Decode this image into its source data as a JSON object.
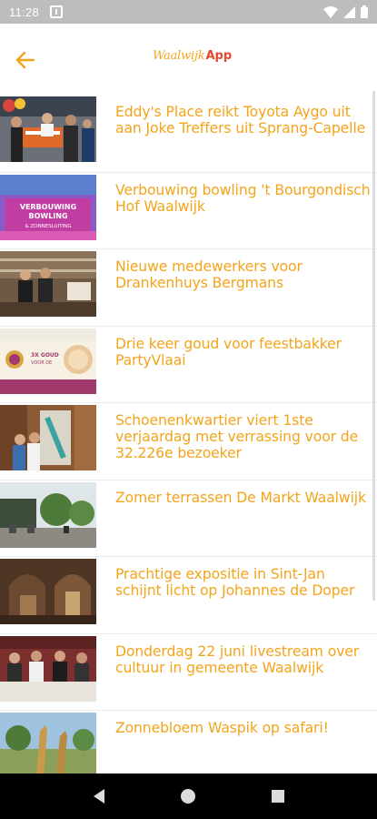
{
  "status_bar": {
    "time": "11:28",
    "icons": [
      "sim-icon",
      "wifi-icon",
      "signal-icon",
      "battery-icon"
    ]
  },
  "header": {
    "back_icon": "arrow-left-icon",
    "logo_text": "Waalwijk",
    "logo_suffix": "App",
    "accent_color": "#f3a41b",
    "logo_accent_color": "#e8452d"
  },
  "articles": [
    {
      "title": "Eddy's Place reikt Toyota Aygo uit aan Joke Treffers uit Sprang-Capelle"
    },
    {
      "title": "Verbouwing bowling 't Bourgondisch Hof Waalwijk"
    },
    {
      "title": "Nieuwe medewerkers voor Drankenhuys Bergmans"
    },
    {
      "title": "Drie keer goud voor feestbakker PartyVlaai"
    },
    {
      "title": "Schoenenkwartier viert 1ste verjaardag met verrassing voor de 32.226e bezoeker"
    },
    {
      "title": "Zomer terrassen De Markt Waalwijk"
    },
    {
      "title": "Prachtige expositie in Sint-Jan schijnt licht op Johannes de Doper"
    },
    {
      "title": "Donderdag 22 juni livestream over cultuur in gemeente Waalwijk"
    },
    {
      "title": "Zonnebloem Waspik op safari!"
    }
  ],
  "thumbnails": {
    "bowling_banner_line1": "VERBOUWING",
    "bowling_banner_line2": "BOWLING",
    "bowling_banner_line3": "& ZONNESLUITING",
    "partyvlaai_badge_line1": "3X GOUD",
    "partyvlaai_badge_line2": "VOOR DE"
  },
  "nav_bar": {
    "icons": [
      "back-triangle-icon",
      "home-circle-icon",
      "recents-square-icon"
    ]
  }
}
